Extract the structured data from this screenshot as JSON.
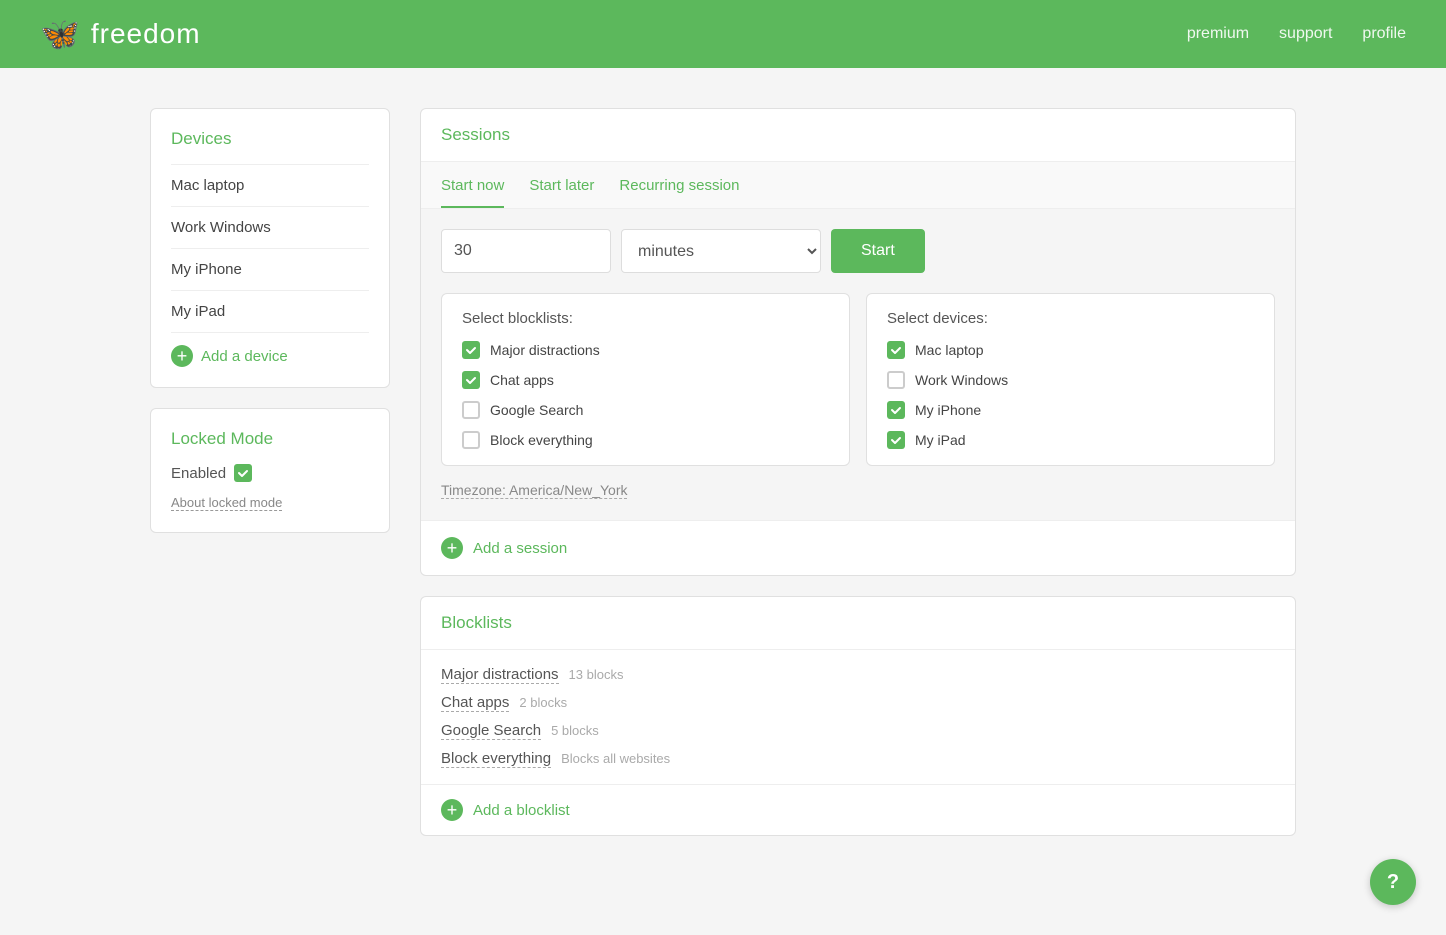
{
  "header": {
    "logo_text": "freedom",
    "nav_items": [
      {
        "label": "premium",
        "name": "premium-link"
      },
      {
        "label": "support",
        "name": "support-link"
      },
      {
        "label": "profile",
        "name": "profile-link"
      }
    ]
  },
  "sidebar": {
    "devices_title": "Devices",
    "devices": [
      {
        "label": "Mac laptop"
      },
      {
        "label": "Work Windows"
      },
      {
        "label": "My iPhone"
      },
      {
        "label": "My iPad"
      }
    ],
    "add_device_label": "Add a device",
    "locked_mode_title": "Locked Mode",
    "locked_mode_enabled_label": "Enabled",
    "locked_mode_checked": true,
    "about_locked_mode_label": "About locked mode"
  },
  "sessions": {
    "title": "Sessions",
    "tabs": [
      {
        "label": "Start now",
        "active": true
      },
      {
        "label": "Start later",
        "active": false
      },
      {
        "label": "Recurring session",
        "active": false
      }
    ],
    "duration_value": "30",
    "duration_unit": "minutes",
    "start_button_label": "Start",
    "select_blocklists_title": "Select blocklists:",
    "blocklists_options": [
      {
        "label": "Major distractions",
        "checked": true
      },
      {
        "label": "Chat apps",
        "checked": true
      },
      {
        "label": "Google Search",
        "checked": false
      },
      {
        "label": "Block everything",
        "checked": false
      }
    ],
    "select_devices_title": "Select devices:",
    "devices_options": [
      {
        "label": "Mac laptop",
        "checked": true
      },
      {
        "label": "Work Windows",
        "checked": false
      },
      {
        "label": "My iPhone",
        "checked": true
      },
      {
        "label": "My iPad",
        "checked": true
      }
    ],
    "timezone_label": "Timezone: America/New_York",
    "add_session_label": "Add a session"
  },
  "blocklists": {
    "title": "Blocklists",
    "items": [
      {
        "name": "Major distractions",
        "count": "13 blocks"
      },
      {
        "name": "Chat apps",
        "count": "2 blocks"
      },
      {
        "name": "Google Search",
        "count": "5 blocks"
      },
      {
        "name": "Block everything",
        "count": "Blocks all websites"
      }
    ],
    "add_label": "Add a blocklist"
  },
  "help": {
    "icon": "?"
  },
  "icons": {
    "checkmark": "✓",
    "plus": "+"
  }
}
